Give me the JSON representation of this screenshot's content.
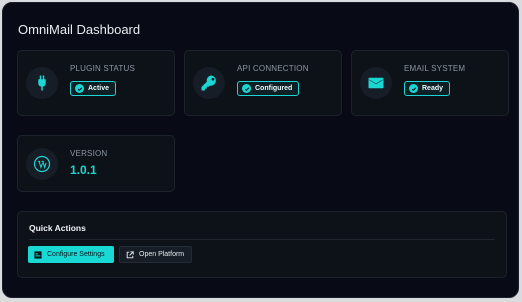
{
  "window": {
    "title": "OmniMail Dashboard"
  },
  "cards": [
    {
      "label": "PLUGIN STATUS",
      "badge": "Active",
      "icon": "plug-icon"
    },
    {
      "label": "API CONNECTION",
      "badge": "Configured",
      "icon": "key-icon"
    },
    {
      "label": "EMAIL SYSTEM",
      "badge": "Ready",
      "icon": "envelope-icon"
    }
  ],
  "version": {
    "label": "VERSION",
    "value": "1.0.1",
    "icon": "wordpress-icon"
  },
  "quick_actions": {
    "title": "Quick Actions",
    "configure_label": "Configure Settings",
    "open_platform_label": "Open Platform"
  },
  "colors": {
    "accent": "#1ad7d3",
    "background": "#080a16",
    "card": "#0d1219"
  }
}
